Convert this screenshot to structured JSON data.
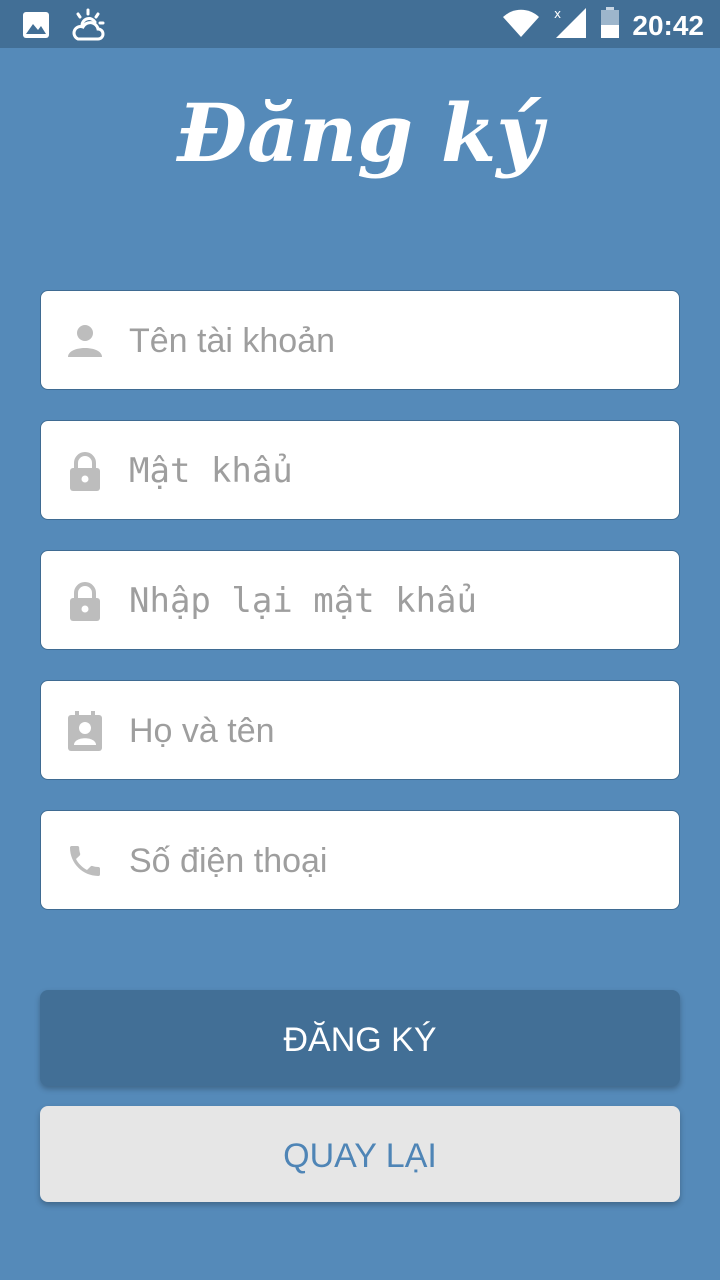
{
  "status_bar": {
    "time": "20:42",
    "icons": [
      "image-icon",
      "weather-icon",
      "wifi-icon",
      "signal-icon",
      "battery-icon"
    ]
  },
  "title": "Đăng ký",
  "form": {
    "username_placeholder": "Tên tài khoản",
    "password_placeholder": "Mật khẩu",
    "confirm_password_placeholder": "Nhập lại mật khẩu",
    "fullname_placeholder": "Họ và tên",
    "phone_placeholder": "Số điện thoại"
  },
  "buttons": {
    "register_label": "ĐĂNG KÝ",
    "back_label": "QUAY LẠI"
  },
  "colors": {
    "background": "#558ab9",
    "status_bar": "#426f96",
    "register_button": "#426f96",
    "back_button": "#e6e6e6",
    "back_text": "#4f85b6",
    "placeholder": "#9e9e9e"
  }
}
